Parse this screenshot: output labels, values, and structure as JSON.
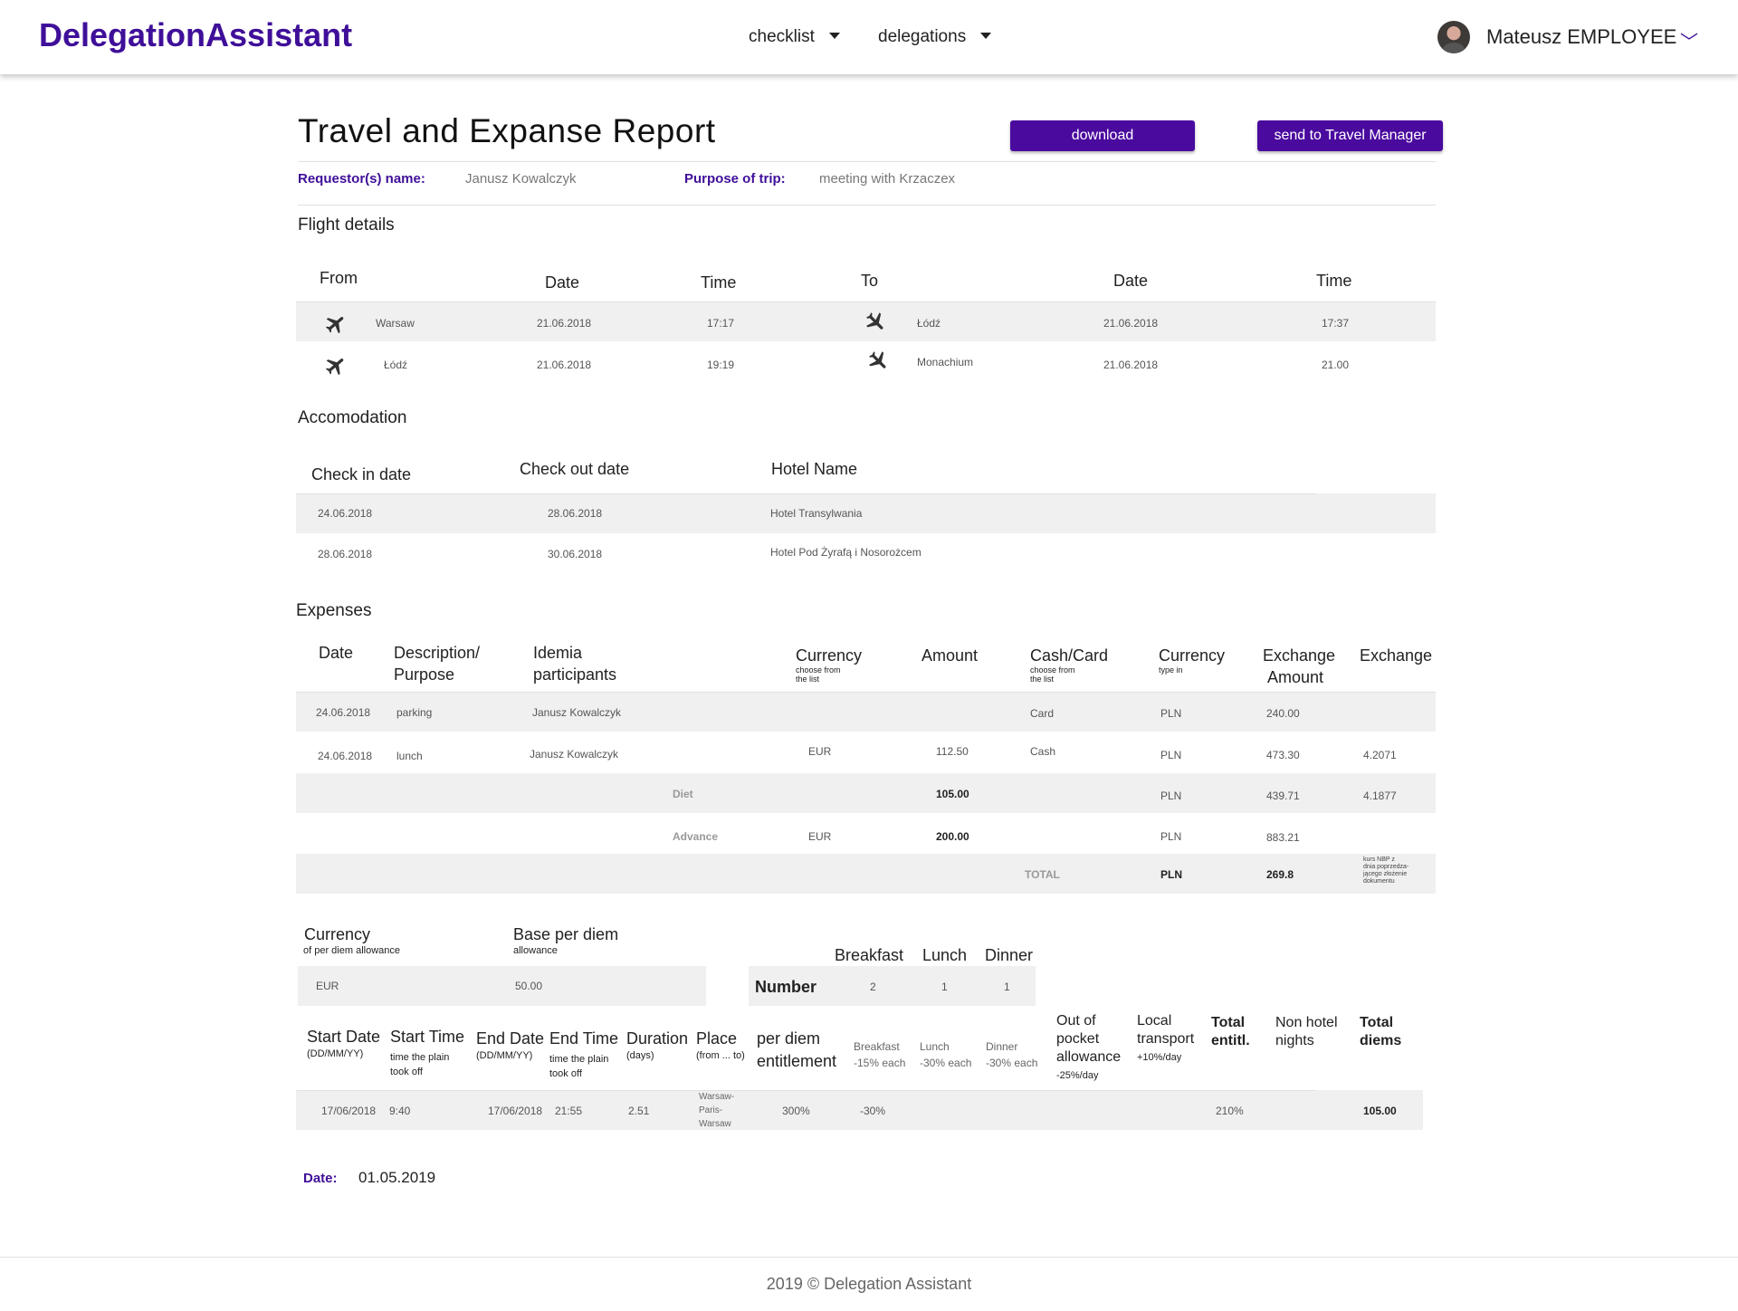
{
  "app": {
    "logo": "DelegationAssistant"
  },
  "nav": {
    "items": [
      {
        "label": "checklist"
      },
      {
        "label": "delegations"
      }
    ]
  },
  "user": {
    "name": "Mateusz EMPLOYEE"
  },
  "page": {
    "title": "Travel and Expanse Report",
    "download_label": "download",
    "send_label": "send to Travel Manager"
  },
  "requestor": {
    "label": "Requestor(s) name:",
    "value": "Janusz Kowalczyk"
  },
  "purpose": {
    "label": "Purpose of trip:",
    "value": "meeting with Krzaczex"
  },
  "flight": {
    "section": "Flight details",
    "headers": {
      "from": "From",
      "date1": "Date",
      "time1": "Time",
      "to": "To",
      "date2": "Date",
      "time2": "Time"
    },
    "rows": [
      {
        "from": "Warsaw",
        "date1": "21.06.2018",
        "time1": "17:17",
        "to": "Łódź",
        "date2": "21.06.2018",
        "time2": "17:37"
      },
      {
        "from": "Łódź",
        "date1": "21.06.2018",
        "time1": "19:19",
        "to": "Monachium",
        "date2": "21.06.2018",
        "time2": "21.00"
      }
    ]
  },
  "accommodation": {
    "section": "Accomodation",
    "headers": {
      "checkin": "Check in date",
      "checkout": "Check out date",
      "hotel": "Hotel Name"
    },
    "rows": [
      {
        "checkin": "24.06.2018",
        "checkout": "28.06.2018",
        "hotel": "Hotel Transylwania"
      },
      {
        "checkin": "28.06.2018",
        "checkout": "30.06.2018",
        "hotel": "Hotel Pod Żyrafą i Nosorożcem"
      }
    ]
  },
  "expenses": {
    "section": "Expenses",
    "headers": {
      "date": "Date",
      "desc1": "Description/",
      "desc2": "Purpose",
      "part1": "Idemia",
      "part2": "participants",
      "currency": "Currency",
      "currency_sub1": "choose from",
      "currency_sub2": "the list",
      "amount": "Amount",
      "cashcard": "Cash/Card",
      "cashcard_sub1": "choose from",
      "cashcard_sub2": "the list",
      "currency2": "Currency",
      "currency2_sub": "type in",
      "exch1": "Exchange",
      "exch2": "Amount",
      "exchange": "Exchange"
    },
    "rows": [
      {
        "date": "24.06.2018",
        "desc": "parking",
        "participants": "Janusz Kowalczyk",
        "currency": "",
        "amount": "",
        "cashcard": "Card",
        "currency2": "PLN",
        "exch_amount": "240.00",
        "exchange": ""
      },
      {
        "date": "24.06.2018",
        "desc": "lunch",
        "participants": "Janusz Kowalczyk",
        "currency": "EUR",
        "amount": "112.50",
        "cashcard": "Cash",
        "currency2": "PLN",
        "exch_amount": "473.30",
        "exchange": "4.2071"
      }
    ],
    "diet": {
      "label": "Diet",
      "amount": "105.00",
      "currency2": "PLN",
      "exch_amount": "439.71",
      "exchange": "4.1877"
    },
    "advance": {
      "label": "Advance",
      "currency": "EUR",
      "amount": "200.00",
      "currency2": "PLN",
      "exch_amount": "883.21"
    },
    "total": {
      "label": "TOTAL",
      "currency": "PLN",
      "value": "269.8",
      "note": [
        "kurs NBP z",
        "dnia poprzedza-",
        "jącego złożenie",
        "dokumentu"
      ]
    }
  },
  "per_diem": {
    "currency_label": "Currency",
    "currency_sub": "of per diem allowance",
    "base_label": "Base per diem",
    "base_sub": "allowance",
    "currency": "EUR",
    "base": "50.00",
    "meals": {
      "headers": {
        "breakfast": "Breakfast",
        "lunch": "Lunch",
        "dinner": "Dinner"
      },
      "number_label": "Number",
      "breakfast": "2",
      "lunch": "1",
      "dinner": "1"
    }
  },
  "diems": {
    "headers": {
      "start_date": "Start Date",
      "start_date_sub": "(DD/MM/YY)",
      "start_time": "Start Time",
      "start_time_sub1": "time the plain",
      "start_time_sub2": "took off",
      "end_date": "End Date",
      "end_date_sub": "(DD/MM/YY)",
      "end_time": "End Time",
      "end_time_sub1": "time the plain",
      "end_time_sub2": "took off",
      "duration": "Duration",
      "duration_sub": "(days)",
      "place": "Place",
      "place_sub": "(from ... to)",
      "entitlement1": "per diem",
      "entitlement2": "entitlement",
      "breakfast": "Breakfast",
      "breakfast_sub": "-15% each",
      "lunch": "Lunch",
      "lunch_sub": "-30% each",
      "dinner": "Dinner",
      "dinner_sub": "-30% each",
      "oop1": "Out of",
      "oop2": "pocket",
      "oop3": "allowance",
      "oop_sub": "-25%/day",
      "local1": "Local",
      "local2": "transport",
      "local_sub": "+10%/day",
      "total_ent1": "Total",
      "total_ent2": "entitl.",
      "nonhotel1": "Non hotel",
      "nonhotel2": "nights",
      "total_diems1": "Total",
      "total_diems2": "diems"
    },
    "row": {
      "start_date": "17/06/2018",
      "start_time": "9:40",
      "end_date": "17/06/2018",
      "end_time": "21:55",
      "duration": "2.51",
      "place1": "Warsaw-",
      "place2": "Paris-",
      "place3": "Warsaw",
      "entitlement": "300%",
      "breakfast": "-30%",
      "total_entitl": "210%",
      "total_diems": "105.00"
    }
  },
  "report_date": {
    "label": "Date:",
    "value": "01.05.2019"
  },
  "footer": {
    "text": "2019 © Delegation Assistant"
  }
}
